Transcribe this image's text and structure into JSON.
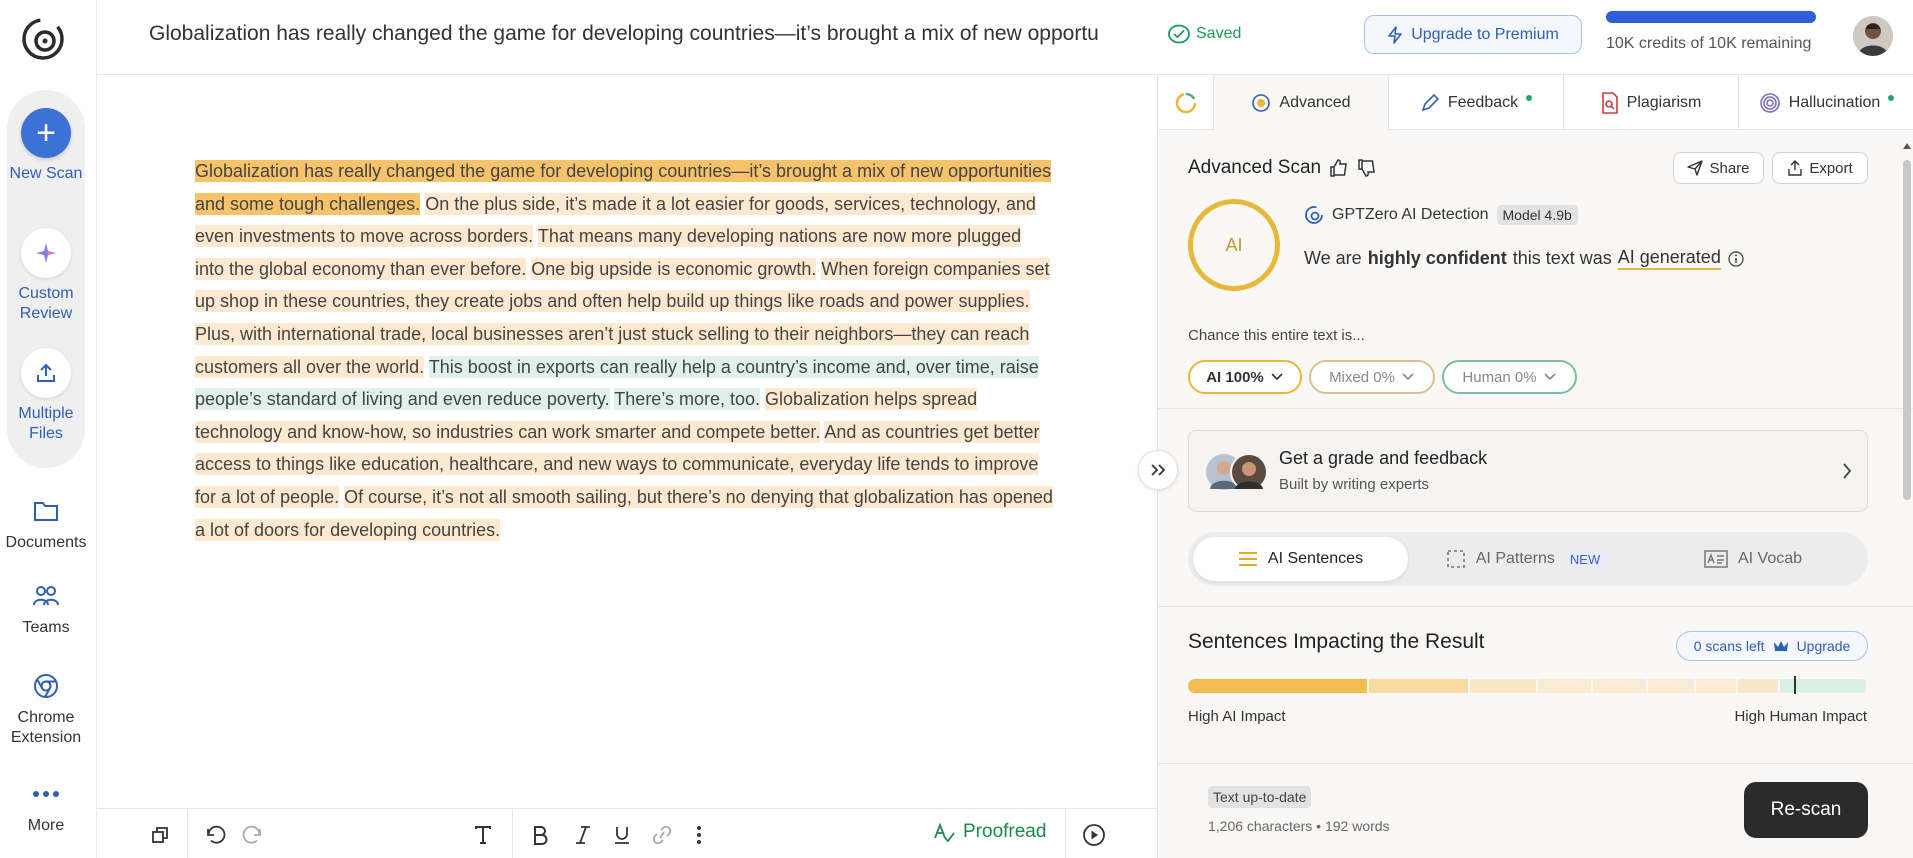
{
  "rail": {
    "new_scan": "New Scan",
    "custom_review": "Custom Review",
    "multiple_files": "Multiple Files",
    "documents": "Documents",
    "teams": "Teams",
    "chrome_extension": "Chrome Extension",
    "more": "More"
  },
  "header": {
    "title": "Globalization has really changed the game for developing countries—it’s brought a mix of new opportu",
    "saved": "Saved",
    "upgrade": "Upgrade to Premium",
    "credits": "10K credits of 10K remaining",
    "credits_fraction": 1.0
  },
  "editor": {
    "sentences": [
      {
        "text": "Globalization has really changed the game for developing countries—it’s brought a mix of new opportunities and some tough challenges.",
        "kind": "ai1"
      },
      {
        "text": "On the plus side, it’s made it a lot easier for goods, services, technology, and even investments to move across borders.",
        "kind": "ai2"
      },
      {
        "text": "That means many developing nations are now more plugged into the global economy than ever before.",
        "kind": "ai2"
      },
      {
        "text": "One big upside is economic growth.",
        "kind": "ai2"
      },
      {
        "text": "When foreign companies set up shop in these countries, they create jobs and often help build up things like roads and power supplies.",
        "kind": "ai2"
      },
      {
        "text": "Plus, with international trade, local businesses aren’t just stuck selling to their neighbors—they can reach customers all over the world.",
        "kind": "ai2"
      },
      {
        "text": "This boost in exports can really help a country’s income and, over time, raise people’s standard of living and even reduce poverty.",
        "kind": "hu"
      },
      {
        "text": "There’s more, too.",
        "kind": "hu"
      },
      {
        "text": "Globalization helps spread technology and know-how, so industries can work smarter and compete better.",
        "kind": "ai2"
      },
      {
        "text": "And as countries get better access to things like education, healthcare, and new ways to communicate, everyday life tends to improve for a lot of people.",
        "kind": "ai2"
      },
      {
        "text": "Of course, it’s not all smooth sailing, but there’s no denying that globalization has opened a lot of doors for developing countries.",
        "kind": "ai2"
      }
    ],
    "proofread": "Proofread"
  },
  "panel": {
    "tabs": [
      {
        "label": "Advanced",
        "active": true,
        "dot": false
      },
      {
        "label": "Feedback",
        "active": false,
        "dot": true
      },
      {
        "label": "Plagiarism",
        "active": false,
        "dot": false
      },
      {
        "label": "Hallucination",
        "active": false,
        "dot": true
      }
    ],
    "scan_title": "Advanced Scan",
    "share": "Share",
    "export": "Export",
    "ring_label": "AI",
    "detector": "GPTZero AI Detection",
    "model": "Model 4.9b",
    "confidence": {
      "pre": "We are",
      "strong": "highly confident",
      "mid": "this text was",
      "result": "AI generated"
    },
    "chance_label": "Chance this entire text is...",
    "chips": [
      {
        "label": "AI 100%",
        "color": "#e8b83a"
      },
      {
        "label": "Mixed 0%",
        "color": "#d8c18a"
      },
      {
        "label": "Human 0%",
        "color": "#7cbfa0"
      }
    ],
    "grade": {
      "title": "Get a grade and feedback",
      "subtitle": "Built by writing experts"
    },
    "segments": [
      {
        "label": "AI Sentences",
        "active": true
      },
      {
        "label": "AI Patterns",
        "badge": "NEW",
        "active": false
      },
      {
        "label": "AI Vocab",
        "active": false
      }
    ],
    "impact_title": "Sentences Impacting the Result",
    "scans_left": "0 scans left",
    "upgrade": "Upgrade",
    "impact_segments": [
      {
        "weight": 0.27,
        "color": "#f2bd4e"
      },
      {
        "weight": 0.15,
        "color": "#f7dba0"
      },
      {
        "weight": 0.1,
        "color": "#f9e6c2"
      },
      {
        "weight": 0.08,
        "color": "#faecd2"
      },
      {
        "weight": 0.08,
        "color": "#faecd2"
      },
      {
        "weight": 0.07,
        "color": "#faecd2"
      },
      {
        "weight": 0.06,
        "color": "#faecd2"
      },
      {
        "weight": 0.06,
        "color": "#f8e7c8"
      },
      {
        "weight": 0.13,
        "color": "#d8efe3"
      }
    ],
    "impact_high_ai": "High AI Impact",
    "impact_high_human": "High Human Impact",
    "text_status": "Text up-to-date",
    "counts": "1,206 characters • 192 words",
    "rescan": "Re-scan"
  }
}
